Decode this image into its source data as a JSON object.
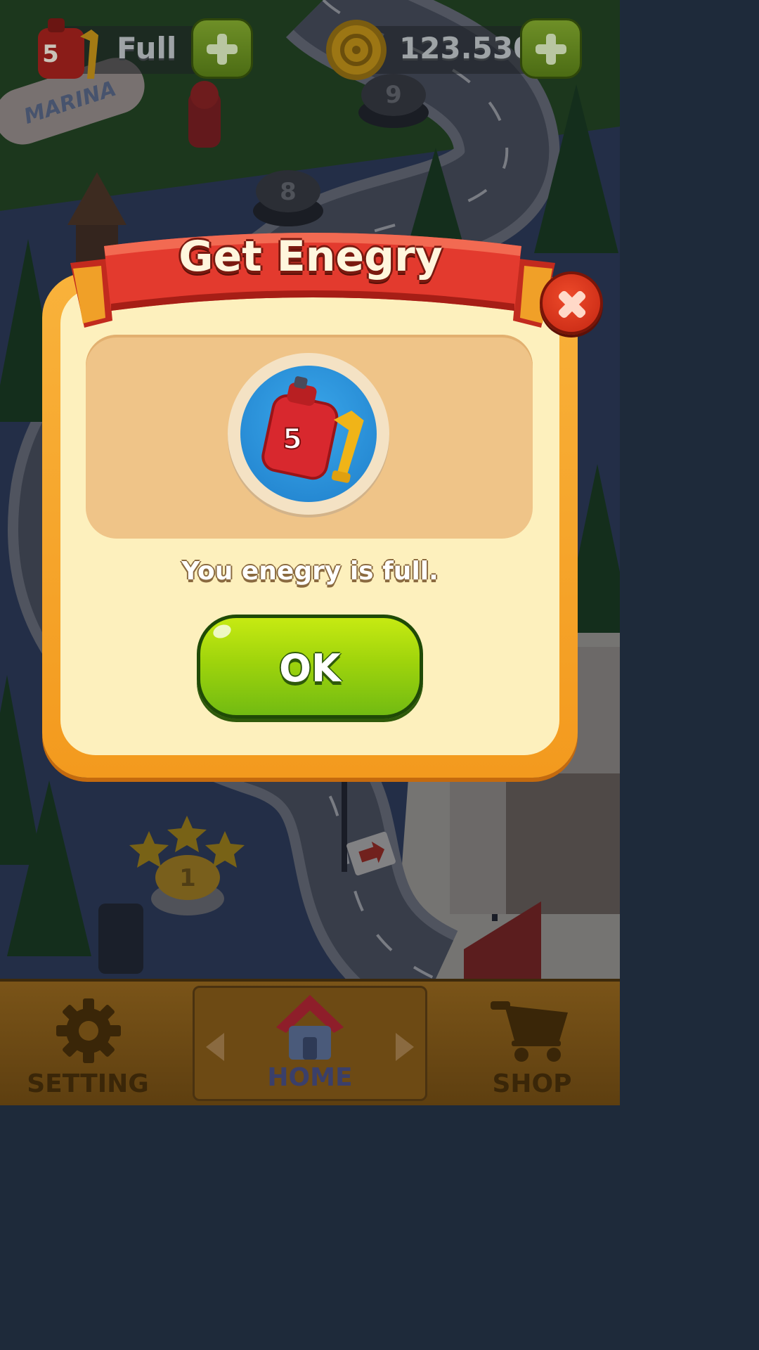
{
  "hud": {
    "energy_count": "5",
    "energy_status": "Full",
    "coins": "123.530"
  },
  "dialog": {
    "title": "Get Enegry",
    "item_count": "5",
    "message": "You enegry is full.",
    "ok_label": "OK"
  },
  "map": {
    "level_labels": [
      "1",
      "8",
      "9"
    ],
    "sign_text": "MARINA"
  },
  "nav": {
    "items": [
      {
        "label": "SETTING",
        "icon": "gear-icon"
      },
      {
        "label": "HOME",
        "icon": "home-icon"
      },
      {
        "label": "SHOP",
        "icon": "cart-icon"
      }
    ]
  },
  "colors": {
    "dialog_frame": "#f6a52a",
    "dialog_body": "#fdf0bd",
    "ribbon": "#e33a2e",
    "ok_button": "#9fd40c",
    "close_button": "#d9331b"
  }
}
